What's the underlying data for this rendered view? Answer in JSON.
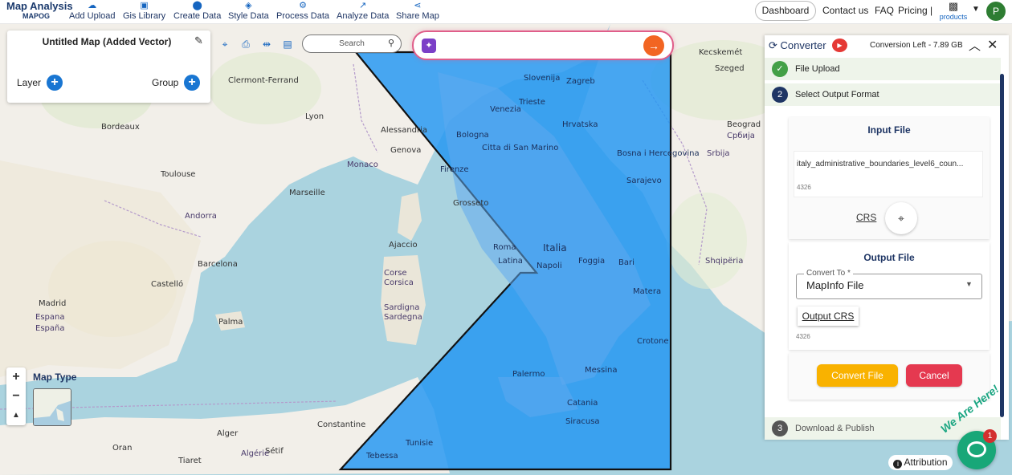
{
  "header": {
    "logo_title": "Map Analysis",
    "logo_subtitle": "MAPOG",
    "nav": [
      {
        "label": "Add Upload",
        "icon": "cloud-upload-icon"
      },
      {
        "label": "Gis Library",
        "icon": "library-icon"
      },
      {
        "label": "Create Data",
        "icon": "location-pin-icon"
      },
      {
        "label": "Style Data",
        "icon": "paint-bucket-icon"
      },
      {
        "label": "Process Data",
        "icon": "process-icon"
      },
      {
        "label": "Analyze Data",
        "icon": "analyze-icon"
      },
      {
        "label": "Share Map",
        "icon": "share-icon"
      }
    ],
    "dashboard": "Dashboard",
    "contact": "Contact us",
    "faq": "FAQ",
    "pricing": "Pricing |",
    "products": "products",
    "avatar_letter": "P"
  },
  "layer_panel": {
    "title": "Untitled Map (Added Vector)",
    "layer_label": "Layer",
    "group_label": "Group"
  },
  "toolbar": {
    "search_placeholder": "Search"
  },
  "map_controls": {
    "zoom_in": "+",
    "zoom_out": "−",
    "reset_north": "▲",
    "map_type_label": "Map Type",
    "attribution": "Attribution"
  },
  "map_labels": {
    "countries": [
      "Slovenija",
      "Hrvatska",
      "Bosna i Hercegovina",
      "Srbija",
      "Србија",
      "Shqipëria",
      "Italia",
      "Monaco",
      "Andorra",
      "Espana",
      "España",
      "Algérie",
      "Tunisie",
      "Sardigna",
      "Sardegna",
      "Corse",
      "Corsica"
    ],
    "cities": [
      {
        "t": "Bordeaux"
      },
      {
        "t": "Toulouse"
      },
      {
        "t": "Marseille"
      },
      {
        "t": "Barcelona"
      },
      {
        "t": "Madrid"
      },
      {
        "t": "Castelló"
      },
      {
        "t": "Palma"
      },
      {
        "t": "Genova"
      },
      {
        "t": "Venezia"
      },
      {
        "t": "Bologna"
      },
      {
        "t": "Firenze"
      },
      {
        "t": "Roma"
      },
      {
        "t": "Napoli"
      },
      {
        "t": "Foggia"
      },
      {
        "t": "Bari"
      },
      {
        "t": "Palermo"
      },
      {
        "t": "Catania"
      },
      {
        "t": "Trieste"
      },
      {
        "t": "Ajaccio"
      },
      {
        "t": "Clermont-Ferrand"
      },
      {
        "t": "Lyon"
      },
      {
        "t": "Alessandria"
      },
      {
        "t": "Grosseto"
      },
      {
        "t": "Latina"
      },
      {
        "t": "Constantine"
      },
      {
        "t": "Alger"
      },
      {
        "t": "Oran"
      },
      {
        "t": "Tiaret"
      },
      {
        "t": "Sétif"
      },
      {
        "t": "Tebessa"
      },
      {
        "t": "Zagreb"
      },
      {
        "t": "Sarajevo"
      },
      {
        "t": "Beograd"
      },
      {
        "t": "Kecskemét"
      },
      {
        "t": "Szeged"
      },
      {
        "t": "Crotone"
      },
      {
        "t": "Siracusa"
      },
      {
        "t": "Messina"
      },
      {
        "t": "Matera"
      },
      {
        "t": "Citta di San Marino"
      }
    ]
  },
  "converter": {
    "title": "Converter",
    "conversion_left": "Conversion Left - 7.89 GB",
    "steps": [
      {
        "num": "✓",
        "label": "File Upload",
        "color": "#43a047"
      },
      {
        "num": "2",
        "label": "Select Output Format",
        "color": "#1e3564"
      },
      {
        "num": "3",
        "label": "Download & Publish",
        "color": "#555555"
      }
    ],
    "input_file_title": "Input File",
    "file_name": "italy_administrative_boundaries_level6_coun...",
    "input_epsg": "4326",
    "crs_label": "CRS",
    "output_file_title": "Output File",
    "convert_to_label": "Convert To *",
    "convert_to_value": "MapInfo File",
    "output_crs_label": "Output CRS",
    "output_epsg": "4326",
    "convert_button": "Convert File",
    "cancel_button": "Cancel"
  },
  "widgets": {
    "we_are_here": "We Are Here!",
    "chat_badge": "1"
  },
  "colors": {
    "brand_navy": "#1e3564",
    "accent_blue": "#1976d2",
    "polygon_fill": "#2196f3",
    "convert_yellow": "#f9b200",
    "cancel_red": "#e53950",
    "ai_border": "#e05e8a",
    "chat_green": "#18a778"
  }
}
